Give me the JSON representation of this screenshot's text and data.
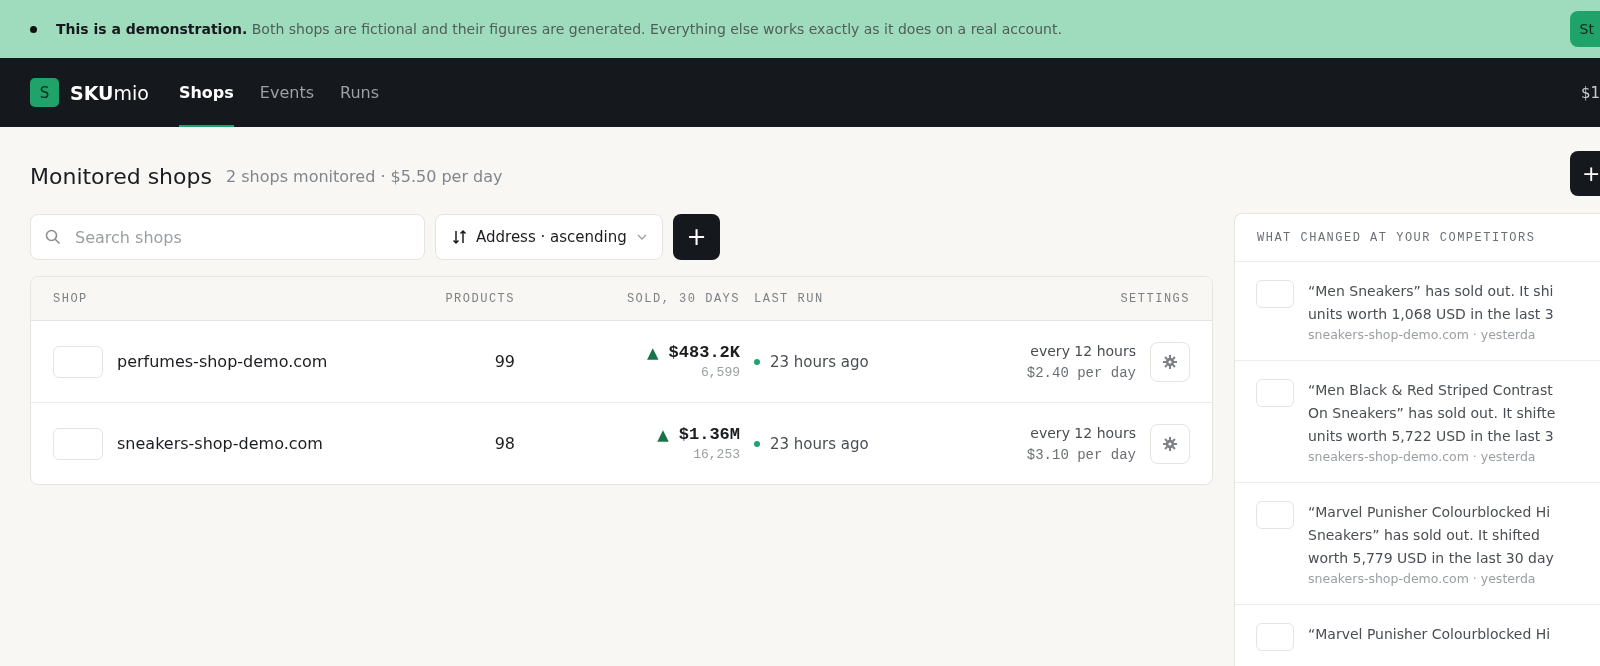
{
  "banner": {
    "bold": "This is a demonstration.",
    "text": "Both shops are fictional and their figures are generated. Everything else works exactly as it does on a real account.",
    "button": "St"
  },
  "nav": {
    "logo_letter": "S",
    "brand_bold": "SKU",
    "brand_rest": "mio",
    "credit": "$1",
    "tabs": [
      {
        "label": "Shops",
        "selected": true
      },
      {
        "label": "Events",
        "selected": false
      },
      {
        "label": "Runs",
        "selected": false
      }
    ]
  },
  "page": {
    "title": "Monitored shops",
    "subtitle": "2 shops monitored · $5.50 per day",
    "add_button": "+"
  },
  "search": {
    "placeholder": "Search shops"
  },
  "sort": {
    "label": "Address · ascending"
  },
  "add_shop_button": "+",
  "table": {
    "columns": [
      "SHOP",
      "PRODUCTS",
      "SOLD, 30 DAYS",
      "LAST RUN",
      "SETTINGS"
    ],
    "rows": [
      {
        "shop": "perfumes-shop-demo.com",
        "products": "99",
        "trend": "▲",
        "sold": "$483.2K",
        "units": "6,599",
        "last_run": "23 hours ago",
        "schedule": "every 12 hours",
        "cost": "$2.40 per day"
      },
      {
        "shop": "sneakers-shop-demo.com",
        "products": "98",
        "trend": "▲",
        "sold": "$1.36M",
        "units": "16,253",
        "last_run": "23 hours ago",
        "schedule": "every 12 hours",
        "cost": "$3.10 per day"
      }
    ]
  },
  "changes": {
    "title": "WHAT CHANGED AT YOUR COMPETITORS",
    "items": [
      {
        "lines": [
          "“Men Sneakers” has sold out. It shi",
          "units worth 1,068 USD in the last 3"
        ],
        "meta": "sneakers-shop-demo.com · yesterda"
      },
      {
        "lines": [
          "“Men Black & Red Striped Contrast",
          "On Sneakers” has sold out. It shifte",
          "units worth 5,722 USD in the last 3"
        ],
        "meta": "sneakers-shop-demo.com · yesterda"
      },
      {
        "lines": [
          "“Marvel Punisher Colourblocked Hi",
          "Sneakers” has sold out. It shifted",
          "worth 5,779 USD in the last 30 day"
        ],
        "meta": "sneakers-shop-demo.com · yesterda"
      },
      {
        "lines": [
          "“Marvel Punisher Colourblocked Hi"
        ]
      }
    ]
  }
}
